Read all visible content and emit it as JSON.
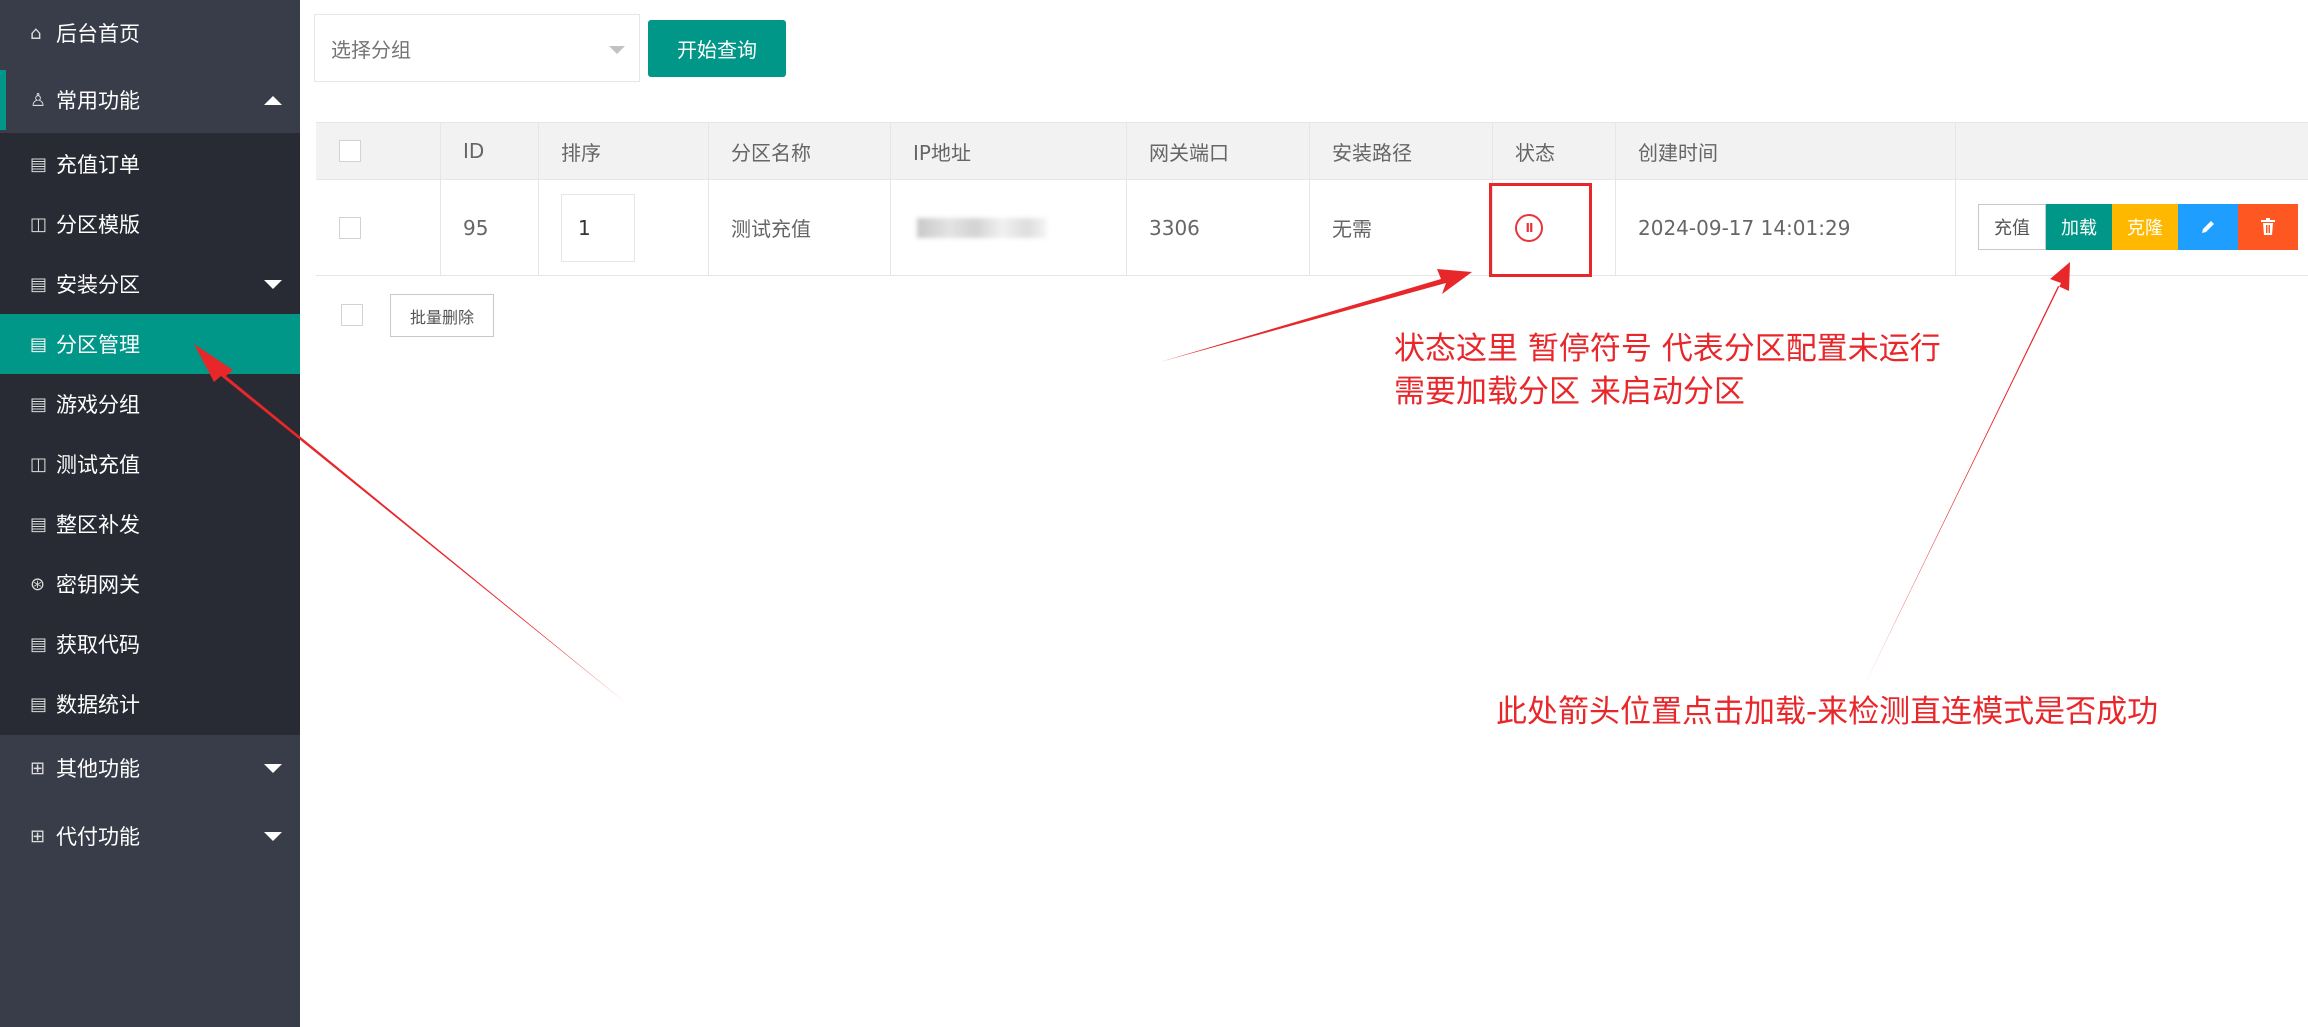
{
  "sidebar": {
    "home": {
      "icon": "home-icon",
      "label": "后台首页"
    },
    "common_group": {
      "icon": "user-icon",
      "label": "常用功能"
    },
    "items": [
      {
        "icon": "document-icon",
        "label": "充值订单"
      },
      {
        "icon": "template-icon",
        "label": "分区模版"
      },
      {
        "icon": "document-icon",
        "label": "安装分区"
      },
      {
        "icon": "document-icon",
        "label": "分区管理"
      },
      {
        "icon": "document-icon",
        "label": "游戏分组"
      },
      {
        "icon": "template-icon",
        "label": "测试充值"
      },
      {
        "icon": "document-icon",
        "label": "整区补发"
      },
      {
        "icon": "download-circle-icon",
        "label": "密钥网关"
      },
      {
        "icon": "document-icon",
        "label": "获取代码"
      },
      {
        "icon": "document-icon",
        "label": "数据统计"
      }
    ],
    "other_group": {
      "icon": "apps-icon",
      "label": "其他功能"
    },
    "pay_group": {
      "icon": "apps-icon",
      "label": "代付功能"
    },
    "active_item": "分区管理"
  },
  "toolbar": {
    "select_placeholder": "选择分组",
    "query_label": "开始查询"
  },
  "table": {
    "headers": [
      "ID",
      "排序",
      "分区名称",
      "IP地址",
      "网关端口",
      "安装路径",
      "状态",
      "创建时间"
    ],
    "rows": [
      {
        "id": "95",
        "sort": "1",
        "name": "测试充值",
        "ip": "",
        "port": "3306",
        "path": "无需",
        "status_icon": "pause-circle-icon",
        "created": "2024-09-17 14:01:29",
        "actions": [
          "充值",
          "加载",
          "克隆",
          "edit-icon",
          "trash-icon"
        ]
      }
    ]
  },
  "batch_delete_label": "批量删除",
  "annotations": {
    "status_note_line1": "状态这里 暂停符号 代表分区配置未运行",
    "status_note_line2": "需要加载分区 来启动分区",
    "load_note": "此处箭头位置点击加载-来检测直连模式是否成功",
    "color": "#e8272b"
  },
  "colors": {
    "sidebar_bg": "#393d49",
    "submenu_bg": "#282b33",
    "accent_green": "#009688",
    "warn_yellow": "#ffb800",
    "info_blue": "#1e9fff",
    "danger_orange": "#ff5722"
  }
}
